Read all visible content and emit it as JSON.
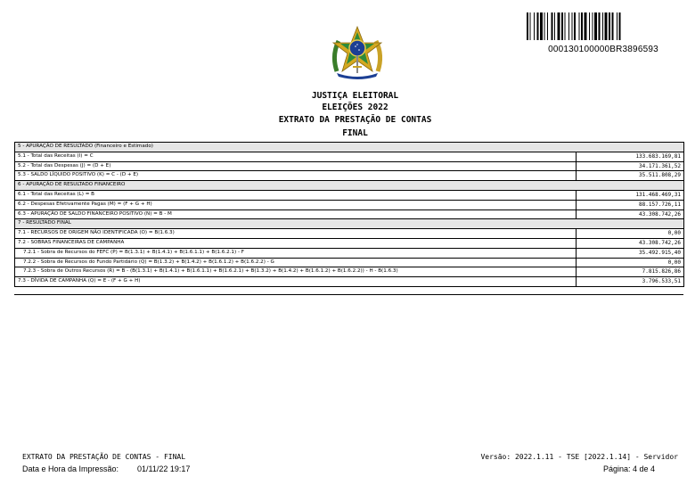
{
  "barcode_number": "000130100000BR3896593",
  "header": {
    "line1": "JUSTIÇA ELEITORAL",
    "line2": "ELEIÇÕES 2022",
    "line3": "EXTRATO DA PRESTAÇÃO DE CONTAS",
    "line4": "FINAL"
  },
  "rows": [
    {
      "label": "5 - APURAÇÃO DE RESULTADO (Financeiro e Estimado)",
      "value": "",
      "section": true
    },
    {
      "label": "5.1 - Total das Receitas (I) = C",
      "value": "133.683.169,81"
    },
    {
      "label": "5.2 - Total das Despesas (J) = (D + E)",
      "value": "34.171.361,52"
    },
    {
      "label": "5.3 - SALDO LÍQUIDO POSITIVO (K) = C - (D + E)",
      "value": "35.511.808,29"
    },
    {
      "label": "6 - APURAÇÃO DE RESULTADO FINANCEIRO",
      "value": "",
      "section": true
    },
    {
      "label": "6.1 - Total das Receitas (L) = B",
      "value": "131.468.469,31"
    },
    {
      "label": "6.2 - Despesas Efetivamente Pagas (M) = (F + G + H)",
      "value": "88.157.726,11"
    },
    {
      "label": "6.3 - APURAÇÃO DE SALDO FINANCEIRO POSITIVO (N) = B - M",
      "value": "43.308.742,26"
    },
    {
      "label": "7 - RESULTADO FINAL",
      "value": "",
      "section": true
    },
    {
      "label": "7.1 - RECURSOS DE ORIGEM NÃO IDENTIFICADA (O) = B(1.6.3)",
      "value": "0,00"
    },
    {
      "label": "7.2 - SOBRAS FINANCEIRAS DE CAMPANHA",
      "value": "43.308.742,26"
    },
    {
      "label": "7.2.1 - Sobra de Recursos do FEFC (P) = B(1.3.1) + B(1.4.1) + B(1.6.1.1) + B(1.6.2.1) - F",
      "value": "35.492.915,40",
      "sub": true
    },
    {
      "label": "7.2.2 - Sobra de Recursos do Fundo Partidário (Q) = B(1.3.2) + B(1.4.2) + B(1.6.1.2) + B(1.6.2.2) - G",
      "value": "0,00",
      "sub": true
    },
    {
      "label": "7.2.3 - Sobra de Outros Recursos (R) = B - (B(1.3.1) + B(1.4.1) + B(1.6.1.1) + B(1.6.2.1) + B(1.3.2) + B(1.4.2) + B(1.6.1.2) + B(1.6.2.2)) - H - B(1.6.3)",
      "value": "7.815.826,86",
      "sub": true
    },
    {
      "label": "7.3 - DÍVIDA DE CAMPANHA (Q) = E - (F + G + H)",
      "value": "3.796.533,51"
    }
  ],
  "footer": {
    "doc_name": "EXTRATO DA PRESTAÇÃO DE CONTAS - FINAL",
    "version": "Versão: 2022.1.11  -  TSE [2022.1.14] - Servidor",
    "print_label": "Data e Hora da Impressão:",
    "print_datetime": "01/11/22 19:17",
    "page": "Página: 4 de  4"
  }
}
